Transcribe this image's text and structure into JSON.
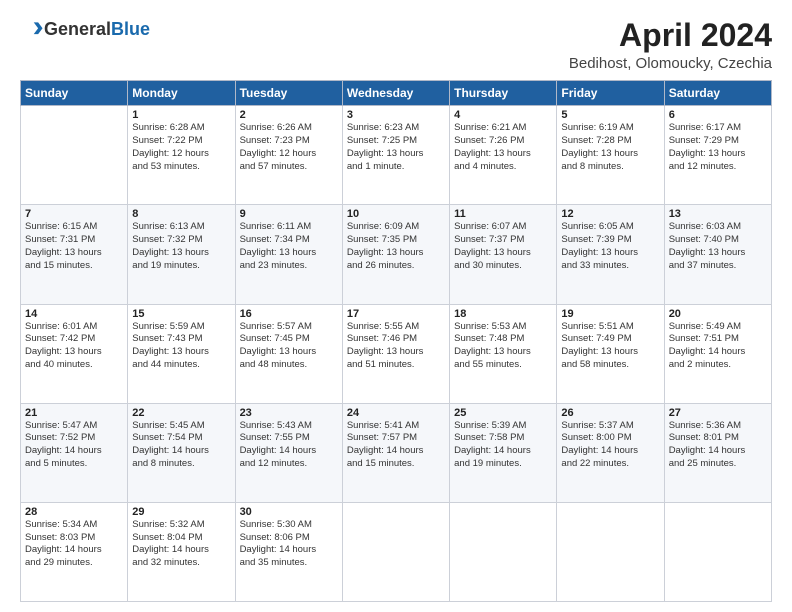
{
  "header": {
    "logo_general": "General",
    "logo_blue": "Blue",
    "title": "April 2024",
    "location": "Bedihost, Olomoucky, Czechia"
  },
  "days_of_week": [
    "Sunday",
    "Monday",
    "Tuesday",
    "Wednesday",
    "Thursday",
    "Friday",
    "Saturday"
  ],
  "weeks": [
    [
      {
        "day": "",
        "info": ""
      },
      {
        "day": "1",
        "info": "Sunrise: 6:28 AM\nSunset: 7:22 PM\nDaylight: 12 hours\nand 53 minutes."
      },
      {
        "day": "2",
        "info": "Sunrise: 6:26 AM\nSunset: 7:23 PM\nDaylight: 12 hours\nand 57 minutes."
      },
      {
        "day": "3",
        "info": "Sunrise: 6:23 AM\nSunset: 7:25 PM\nDaylight: 13 hours\nand 1 minute."
      },
      {
        "day": "4",
        "info": "Sunrise: 6:21 AM\nSunset: 7:26 PM\nDaylight: 13 hours\nand 4 minutes."
      },
      {
        "day": "5",
        "info": "Sunrise: 6:19 AM\nSunset: 7:28 PM\nDaylight: 13 hours\nand 8 minutes."
      },
      {
        "day": "6",
        "info": "Sunrise: 6:17 AM\nSunset: 7:29 PM\nDaylight: 13 hours\nand 12 minutes."
      }
    ],
    [
      {
        "day": "7",
        "info": "Sunrise: 6:15 AM\nSunset: 7:31 PM\nDaylight: 13 hours\nand 15 minutes."
      },
      {
        "day": "8",
        "info": "Sunrise: 6:13 AM\nSunset: 7:32 PM\nDaylight: 13 hours\nand 19 minutes."
      },
      {
        "day": "9",
        "info": "Sunrise: 6:11 AM\nSunset: 7:34 PM\nDaylight: 13 hours\nand 23 minutes."
      },
      {
        "day": "10",
        "info": "Sunrise: 6:09 AM\nSunset: 7:35 PM\nDaylight: 13 hours\nand 26 minutes."
      },
      {
        "day": "11",
        "info": "Sunrise: 6:07 AM\nSunset: 7:37 PM\nDaylight: 13 hours\nand 30 minutes."
      },
      {
        "day": "12",
        "info": "Sunrise: 6:05 AM\nSunset: 7:39 PM\nDaylight: 13 hours\nand 33 minutes."
      },
      {
        "day": "13",
        "info": "Sunrise: 6:03 AM\nSunset: 7:40 PM\nDaylight: 13 hours\nand 37 minutes."
      }
    ],
    [
      {
        "day": "14",
        "info": "Sunrise: 6:01 AM\nSunset: 7:42 PM\nDaylight: 13 hours\nand 40 minutes."
      },
      {
        "day": "15",
        "info": "Sunrise: 5:59 AM\nSunset: 7:43 PM\nDaylight: 13 hours\nand 44 minutes."
      },
      {
        "day": "16",
        "info": "Sunrise: 5:57 AM\nSunset: 7:45 PM\nDaylight: 13 hours\nand 48 minutes."
      },
      {
        "day": "17",
        "info": "Sunrise: 5:55 AM\nSunset: 7:46 PM\nDaylight: 13 hours\nand 51 minutes."
      },
      {
        "day": "18",
        "info": "Sunrise: 5:53 AM\nSunset: 7:48 PM\nDaylight: 13 hours\nand 55 minutes."
      },
      {
        "day": "19",
        "info": "Sunrise: 5:51 AM\nSunset: 7:49 PM\nDaylight: 13 hours\nand 58 minutes."
      },
      {
        "day": "20",
        "info": "Sunrise: 5:49 AM\nSunset: 7:51 PM\nDaylight: 14 hours\nand 2 minutes."
      }
    ],
    [
      {
        "day": "21",
        "info": "Sunrise: 5:47 AM\nSunset: 7:52 PM\nDaylight: 14 hours\nand 5 minutes."
      },
      {
        "day": "22",
        "info": "Sunrise: 5:45 AM\nSunset: 7:54 PM\nDaylight: 14 hours\nand 8 minutes."
      },
      {
        "day": "23",
        "info": "Sunrise: 5:43 AM\nSunset: 7:55 PM\nDaylight: 14 hours\nand 12 minutes."
      },
      {
        "day": "24",
        "info": "Sunrise: 5:41 AM\nSunset: 7:57 PM\nDaylight: 14 hours\nand 15 minutes."
      },
      {
        "day": "25",
        "info": "Sunrise: 5:39 AM\nSunset: 7:58 PM\nDaylight: 14 hours\nand 19 minutes."
      },
      {
        "day": "26",
        "info": "Sunrise: 5:37 AM\nSunset: 8:00 PM\nDaylight: 14 hours\nand 22 minutes."
      },
      {
        "day": "27",
        "info": "Sunrise: 5:36 AM\nSunset: 8:01 PM\nDaylight: 14 hours\nand 25 minutes."
      }
    ],
    [
      {
        "day": "28",
        "info": "Sunrise: 5:34 AM\nSunset: 8:03 PM\nDaylight: 14 hours\nand 29 minutes."
      },
      {
        "day": "29",
        "info": "Sunrise: 5:32 AM\nSunset: 8:04 PM\nDaylight: 14 hours\nand 32 minutes."
      },
      {
        "day": "30",
        "info": "Sunrise: 5:30 AM\nSunset: 8:06 PM\nDaylight: 14 hours\nand 35 minutes."
      },
      {
        "day": "",
        "info": ""
      },
      {
        "day": "",
        "info": ""
      },
      {
        "day": "",
        "info": ""
      },
      {
        "day": "",
        "info": ""
      }
    ]
  ]
}
